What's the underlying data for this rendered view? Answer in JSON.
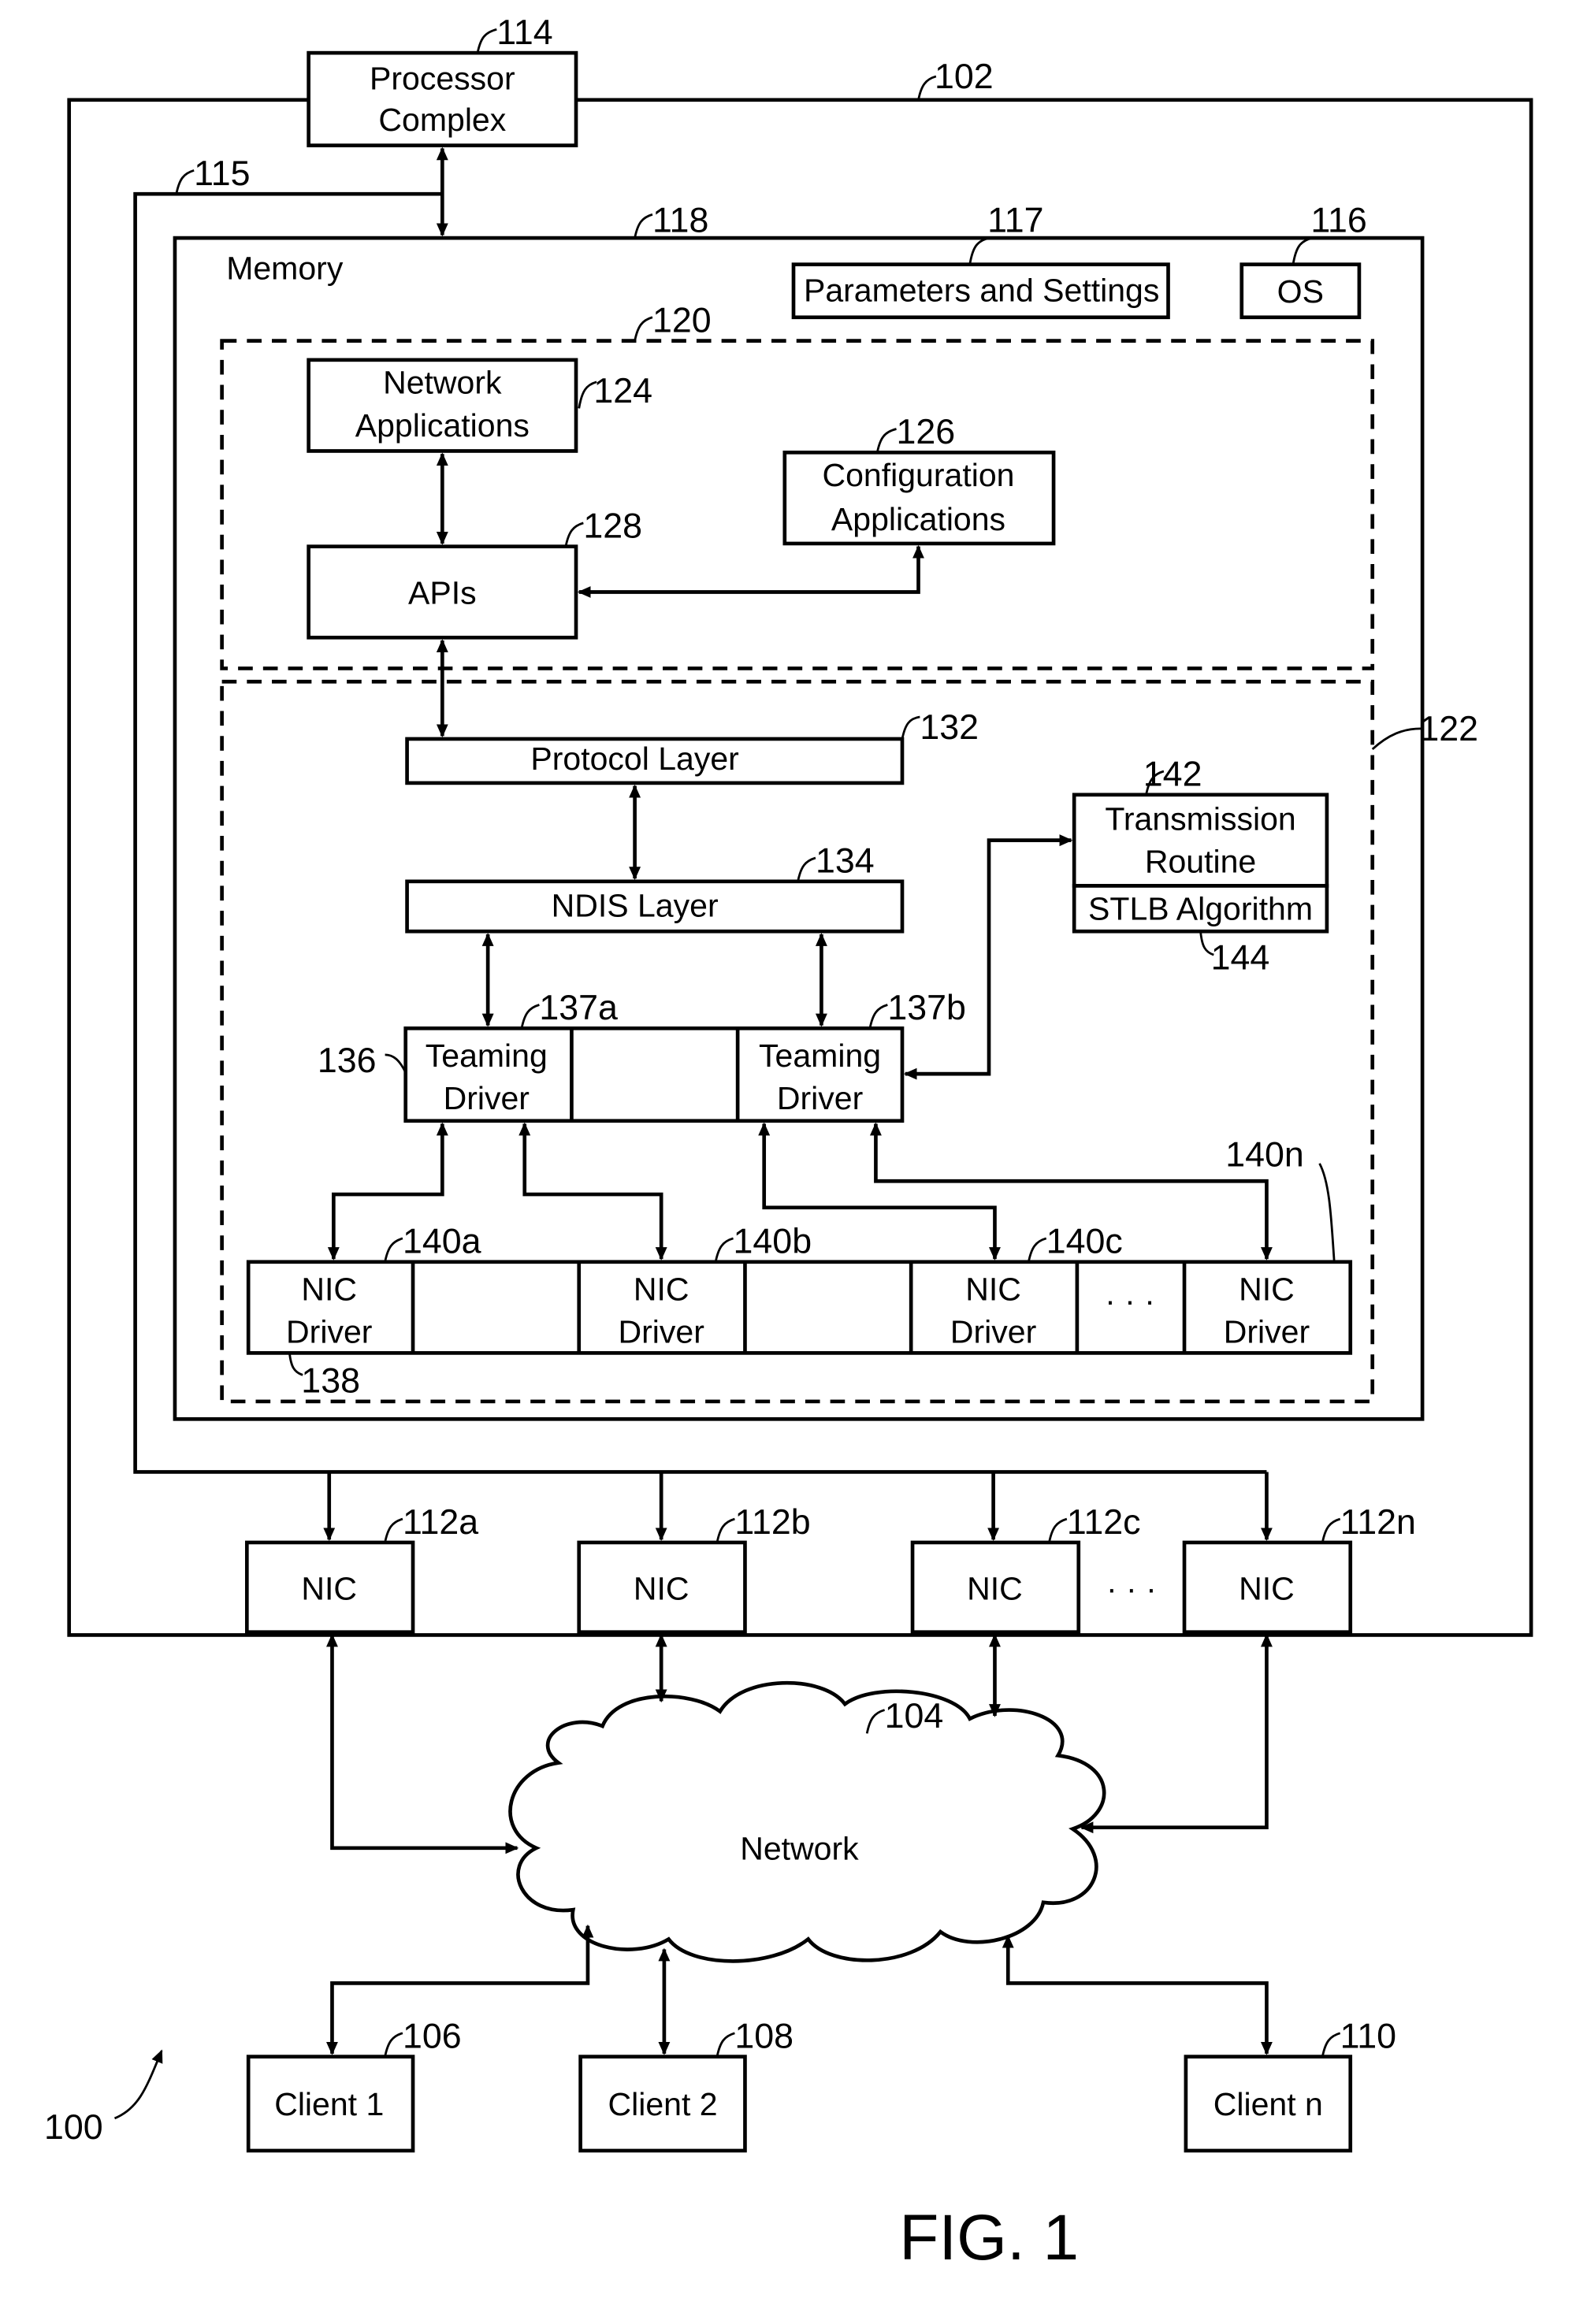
{
  "figure": {
    "caption": "FIG. 1",
    "system_ref": "100"
  },
  "refs": {
    "r102": "102",
    "r114": "114",
    "r115": "115",
    "r118": "118",
    "r117": "117",
    "r116": "116",
    "r120": "120",
    "r124": "124",
    "r126": "126",
    "r128": "128",
    "r122": "122",
    "r132": "132",
    "r134": "134",
    "r142": "142",
    "r144": "144",
    "r136": "136",
    "r137a": "137a",
    "r137b": "137b",
    "r140a": "140a",
    "r140b": "140b",
    "r140c": "140c",
    "r140n": "140n",
    "r138": "138",
    "r112a": "112a",
    "r112b": "112b",
    "r112c": "112c",
    "r112n": "112n",
    "r104": "104",
    "r106": "106",
    "r108": "108",
    "r110": "110"
  },
  "blocks": {
    "processor": [
      "Processor",
      "Complex"
    ],
    "memory": "Memory",
    "params": "Parameters and Settings",
    "os": "OS",
    "netapps": [
      "Network",
      "Applications"
    ],
    "config": [
      "Configuration",
      "Applications"
    ],
    "apis": "APIs",
    "protocol": "Protocol Layer",
    "ndis": "NDIS Layer",
    "transmission": [
      "Transmission",
      "Routine"
    ],
    "stlb": "STLB Algorithm",
    "teaming": [
      "Teaming",
      "Driver"
    ],
    "nicdriver": [
      "NIC",
      "Driver"
    ],
    "nic": "NIC",
    "ellipsis": "· · ·",
    "network": "Network",
    "clients": [
      "Client 1",
      "Client 2",
      "Client n"
    ]
  }
}
